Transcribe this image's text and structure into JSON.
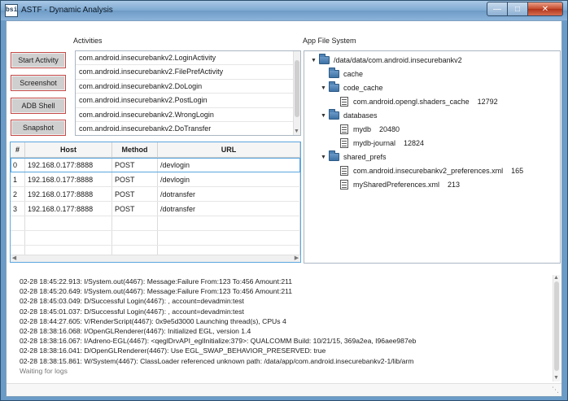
{
  "window": {
    "icon_text": "bsi",
    "title": "ASTF - Dynamic Analysis",
    "minimize_glyph": "—",
    "maximize_glyph": "□",
    "close_glyph": "✕"
  },
  "activities_panel": {
    "label": "Activities",
    "buttons": [
      "Start Activity",
      "Screenshot",
      "ADB Shell",
      "Snapshot"
    ],
    "items": [
      "com.android.insecurebankv2.LoginActivity",
      "com.android.insecurebankv2.FilePrefActivity",
      "com.android.insecurebankv2.DoLogin",
      "com.android.insecurebankv2.PostLogin",
      "com.android.insecurebankv2.WrongLogin",
      "com.android.insecurebankv2.DoTransfer"
    ]
  },
  "requests_table": {
    "columns": [
      "#",
      "Host",
      "Method",
      "URL"
    ],
    "rows": [
      [
        "0",
        "192.168.0.177:8888",
        "POST",
        "/devlogin"
      ],
      [
        "1",
        "192.168.0.177:8888",
        "POST",
        "/devlogin"
      ],
      [
        "2",
        "192.168.0.177:8888",
        "POST",
        "/dotransfer"
      ],
      [
        "3",
        "192.168.0.177:8888",
        "POST",
        "/dotransfer"
      ]
    ]
  },
  "file_system": {
    "label": "App File System",
    "root": "/data/data/com.android.insecurebankv2",
    "cache": "cache",
    "code_cache": "code_cache",
    "code_cache_file": {
      "name": "com.android.opengl.shaders_cache",
      "size": "12792"
    },
    "databases": "databases",
    "db_files": [
      {
        "name": "mydb",
        "size": "20480"
      },
      {
        "name": "mydb-journal",
        "size": "12824"
      }
    ],
    "shared_prefs": "shared_prefs",
    "pref_files": [
      {
        "name": "com.android.insecurebankv2_preferences.xml",
        "size": "165"
      },
      {
        "name": "mySharedPreferences.xml",
        "size": "213"
      }
    ]
  },
  "log": {
    "lines": [
      "02-28 18:45:22.913: I/System.out(4467): Message:Failure From:123 To:456 Amount:211",
      "02-28 18:45:20.649: I/System.out(4467): Message:Failure From:123 To:456 Amount:211",
      "02-28 18:45:03.049: D/Successful Login(4467): , account=devadmin:test",
      "02-28 18:45:01.037: D/Successful Login(4467): , account=devadmin:test",
      "02-28 18:44:27.605: V/RenderScript(4467): 0x9e5d3000 Launching thread(s), CPUs 4",
      "02-28 18:38:16.068: I/OpenGLRenderer(4467): Initialized EGL, version 1.4",
      "02-28 18:38:16.067: I/Adreno-EGL(4467): <qeglDrvAPI_eglInitialize:379>: QUALCOMM Build: 10/21/15, 369a2ea, I96aee987eb",
      "02-28 18:38:16.041: D/OpenGLRenderer(4467): Use EGL_SWAP_BEHAVIOR_PRESERVED: true",
      "02-28 18:38:15.861: W/System(4467): ClassLoader referenced unknown path: /data/app/com.android.insecurebankv2-1/lib/arm"
    ],
    "waiting": "Waiting for logs"
  },
  "colors": {
    "title_bar": "#7ea9d1",
    "button_border": "#c44a47",
    "selection_outline": "#5aa6de",
    "folder": "#3f73a6"
  },
  "icons": [
    "app-icon",
    "folder-icon",
    "file-icon",
    "expand-arrow-icon",
    "scroll-arrow-icon",
    "resize-grip-icon"
  ]
}
